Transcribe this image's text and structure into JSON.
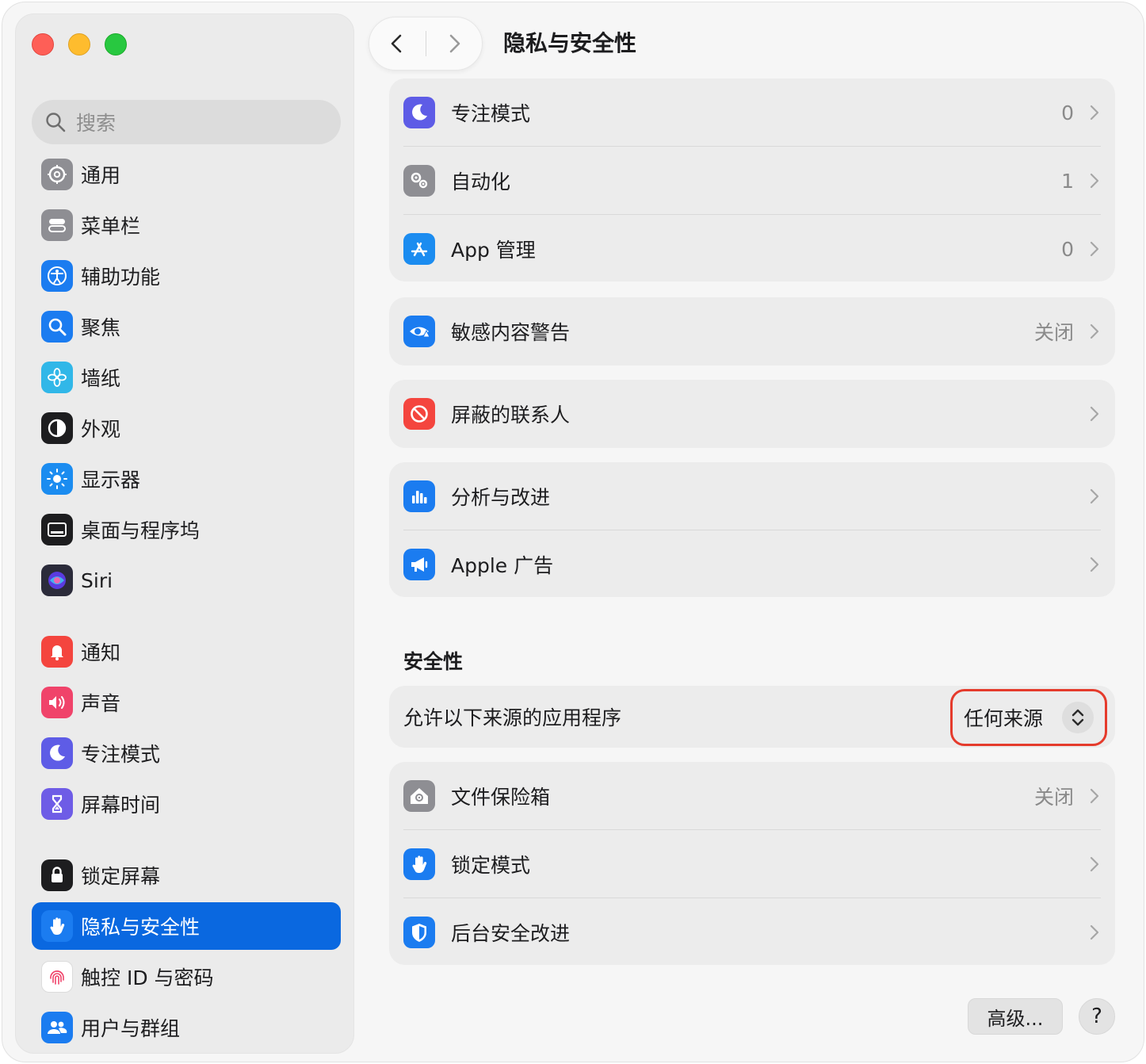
{
  "window": {
    "title": "隐私与安全性"
  },
  "search": {
    "placeholder": "搜索"
  },
  "sidebar": {
    "items": [
      {
        "label": "通用",
        "icon": "gear-icon",
        "color": "#8e8e93"
      },
      {
        "label": "菜单栏",
        "icon": "menubar-icon",
        "color": "#8e8e93"
      },
      {
        "label": "辅助功能",
        "icon": "accessibility-icon",
        "color": "#1b7cf0"
      },
      {
        "label": "聚焦",
        "icon": "spotlight-icon",
        "color": "#1b7cf0"
      },
      {
        "label": "墙纸",
        "icon": "wallpaper-icon",
        "color": "#31b7e8"
      },
      {
        "label": "外观",
        "icon": "appearance-icon",
        "color": "#1d1d1f"
      },
      {
        "label": "显示器",
        "icon": "display-icon",
        "color": "#1b8cf0"
      },
      {
        "label": "桌面与程序坞",
        "icon": "dock-icon",
        "color": "#1d1d1f"
      },
      {
        "label": "Siri",
        "icon": "siri-icon",
        "color": "#2b2b3a"
      },
      {
        "label": "通知",
        "icon": "notification-icon",
        "color": "#f4453e"
      },
      {
        "label": "声音",
        "icon": "sound-icon",
        "color": "#f0436a"
      },
      {
        "label": "专注模式",
        "icon": "moon-icon",
        "color": "#5e5ce6"
      },
      {
        "label": "屏幕时间",
        "icon": "hourglass-icon",
        "color": "#6e5ce6"
      },
      {
        "label": "锁定屏幕",
        "icon": "lock-icon",
        "color": "#1d1d1f"
      },
      {
        "label": "隐私与安全性",
        "icon": "hand-icon",
        "color": "#1b7cf0",
        "active": true
      },
      {
        "label": "触控 ID 与密码",
        "icon": "fingerprint-icon",
        "color": "#ffffff"
      },
      {
        "label": "用户与群组",
        "icon": "users-icon",
        "color": "#1b7cf0"
      }
    ]
  },
  "main": {
    "group1": [
      {
        "label": "专注模式",
        "value": "0",
        "icon": "moon-icon",
        "color": "#5e5ce6"
      },
      {
        "label": "自动化",
        "value": "1",
        "icon": "gears-icon",
        "color": "#8e8e93"
      },
      {
        "label": "App 管理",
        "value": "0",
        "icon": "appstore-icon",
        "color": "#1b8cf0"
      }
    ],
    "group2": [
      {
        "label": "敏感内容警告",
        "value": "关闭",
        "icon": "eye-warning-icon",
        "color": "#1b7cf0"
      }
    ],
    "group3": [
      {
        "label": "屏蔽的联系人",
        "value": "",
        "icon": "blocked-icon",
        "color": "#f4453e"
      }
    ],
    "group4": [
      {
        "label": "分析与改进",
        "value": "",
        "icon": "analytics-icon",
        "color": "#1b7cf0"
      },
      {
        "label": "Apple 广告",
        "value": "",
        "icon": "megaphone-icon",
        "color": "#1b7cf0"
      }
    ],
    "security_title": "安全性",
    "source": {
      "label": "允许以下来源的应用程序",
      "value": "任何来源"
    },
    "group5": [
      {
        "label": "文件保险箱",
        "value": "关闭",
        "icon": "filevault-icon",
        "color": "#8e8e93"
      },
      {
        "label": "锁定模式",
        "value": "",
        "icon": "hand-icon",
        "color": "#1b7cf0"
      },
      {
        "label": "后台安全改进",
        "value": "",
        "icon": "shield-icon",
        "color": "#1b7cf0"
      }
    ],
    "advanced_label": "高级...",
    "help_label": "?"
  }
}
